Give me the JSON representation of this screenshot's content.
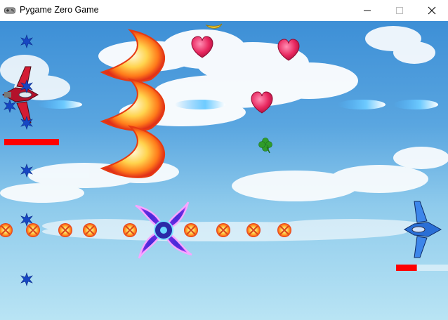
{
  "window": {
    "title": "Pygame Zero Game",
    "icon": "gamepad-icon",
    "controls": {
      "minimize_icon": "minimize-icon",
      "maximize_icon": "maximize-icon",
      "close_icon": "close-icon"
    }
  },
  "game": {
    "sky_colors": {
      "top": "#3d8fd6",
      "bottom": "#b9e4f4"
    },
    "player_ship": {
      "icon": "red-fighter-jet-icon",
      "health_fraction": 1.0,
      "health_color": "#ff0000"
    },
    "enemy_ship": {
      "icon": "blue-fighter-jet-icon",
      "health_fraction": 0.38,
      "health_color": "#ff0000"
    },
    "sprites": [
      "blue-snowflake-icon",
      "fire-crescent-icon",
      "blue-laser-bolt-icon",
      "heart-icon",
      "clover-icon",
      "banana-icon",
      "fireball-icon",
      "purple-shuriken-icon"
    ]
  }
}
